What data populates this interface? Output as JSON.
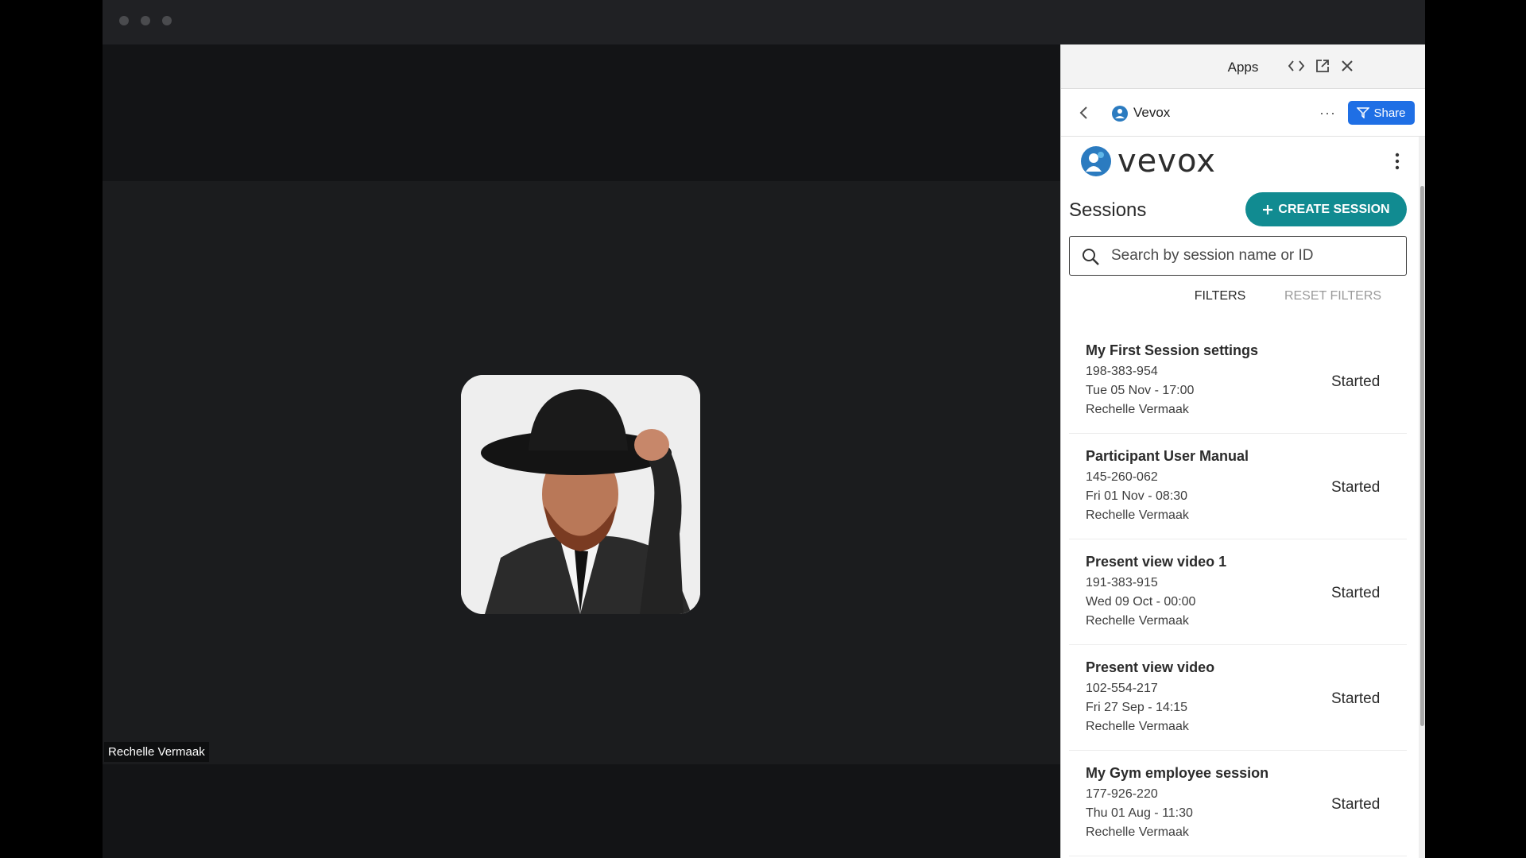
{
  "apps_panel": {
    "title": "Apps",
    "app_name": "Vevox",
    "more_label": "···",
    "share_label": "Share"
  },
  "meeting": {
    "participant_name": "Rechelle Vermaak"
  },
  "vevox": {
    "logo_text": "vevox",
    "sessions_title": "Sessions",
    "create_label": "CREATE SESSION",
    "search_placeholder": "Search by session name or ID",
    "filters_label": "FILTERS",
    "reset_filters_label": "RESET FILTERS",
    "accent_color": "#118b91",
    "sessions": [
      {
        "name": "My First Session settings",
        "id": "198-383-954",
        "date": "Tue 05 Nov - 17:00",
        "owner": "Rechelle Vermaak",
        "status": "Started"
      },
      {
        "name": "Participant User Manual",
        "id": "145-260-062",
        "date": "Fri 01 Nov - 08:30",
        "owner": "Rechelle Vermaak",
        "status": "Started"
      },
      {
        "name": "Present view video 1",
        "id": "191-383-915",
        "date": "Wed 09 Oct - 00:00",
        "owner": "Rechelle Vermaak",
        "status": "Started"
      },
      {
        "name": "Present view video",
        "id": "102-554-217",
        "date": "Fri 27 Sep - 14:15",
        "owner": "Rechelle Vermaak",
        "status": "Started"
      },
      {
        "name": "My Gym employee session",
        "id": "177-926-220",
        "date": "Thu 01 Aug - 11:30",
        "owner": "Rechelle Vermaak",
        "status": "Started"
      }
    ]
  }
}
